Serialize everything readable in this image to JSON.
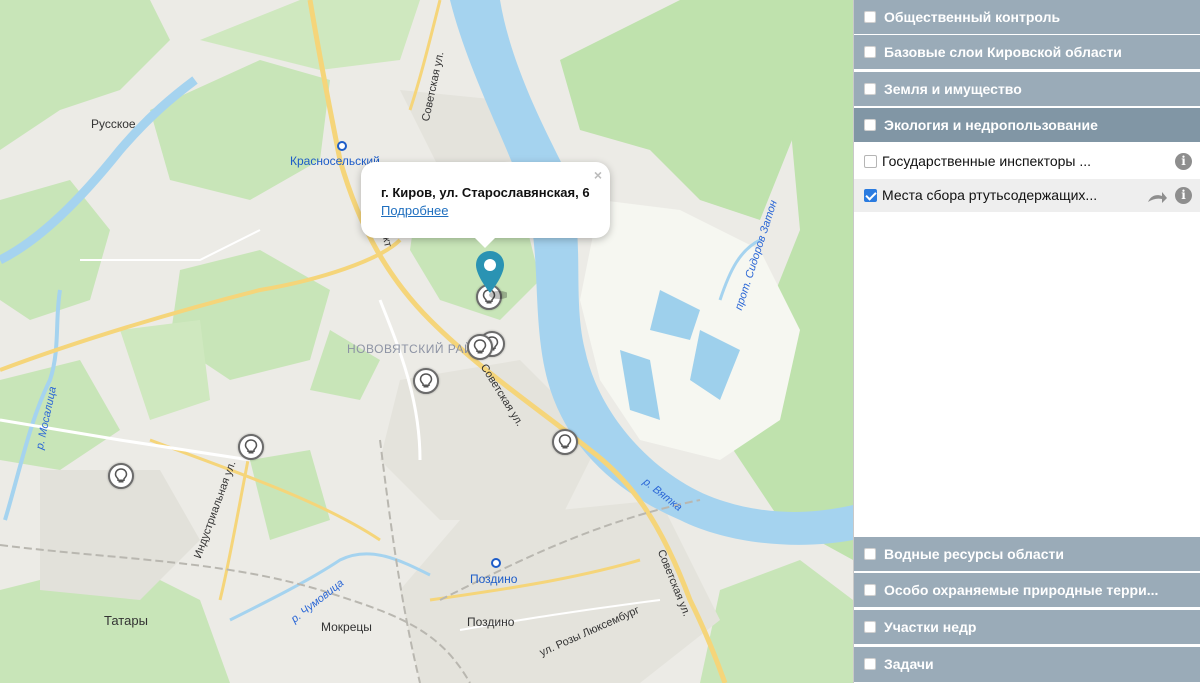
{
  "map": {
    "popup": {
      "address": "г. Киров, ул. Старославянская, 6",
      "details_link": "Подробнее",
      "close_symbol": "×"
    },
    "labels": {
      "russkoe": "Русское",
      "krasnoselsky": "Красносельский",
      "district": "НОВОВЯТСКИЙ РАЙОН",
      "sovetskaya_top": "Советская ул.",
      "sovetskaya_mid": "Советская ул.",
      "sovetskaya_bottom": "Советская ул.",
      "trakt": "Тракт",
      "industrialnaya": "Индустриальная ул.",
      "chumovica": "р. Чумовица",
      "mosalica": "р. Мосалица",
      "vyatka": "р. Вятка",
      "sidorov_zaton": "прот. Сидоров Затон",
      "pozdino_station": "Поздино",
      "pozdino": "Поздино",
      "mokrecy": "Мокрецы",
      "tatary": "Татары",
      "rozy_luxemburg": "ул. Розы Люксембург"
    },
    "marker_icon": "lightbulb-icon",
    "pin_color": "#2a93b3"
  },
  "sidebar": {
    "sections_top": [
      {
        "label": "Общественный контроль",
        "active": false
      },
      {
        "label": "Базовые слои Кировской области",
        "active": false
      },
      {
        "label": "Земля и имущество",
        "active": false
      },
      {
        "label": "Экология и недропользование",
        "active": true
      }
    ],
    "layers": [
      {
        "label": "Государственные инспекторы ...",
        "checked": false
      },
      {
        "label": "Места сбора ртутьсодержащих...",
        "checked": true
      }
    ],
    "sections_bottom": [
      {
        "label": "Водные ресурсы области"
      },
      {
        "label": "Особо охраняемые природные терри..."
      },
      {
        "label": "Участки недр"
      },
      {
        "label": "Задачи"
      }
    ],
    "colors": {
      "section_bg": "#9aabb8",
      "section_active_bg": "#8196a5",
      "checkbox_checked": "#2a7be0"
    }
  }
}
